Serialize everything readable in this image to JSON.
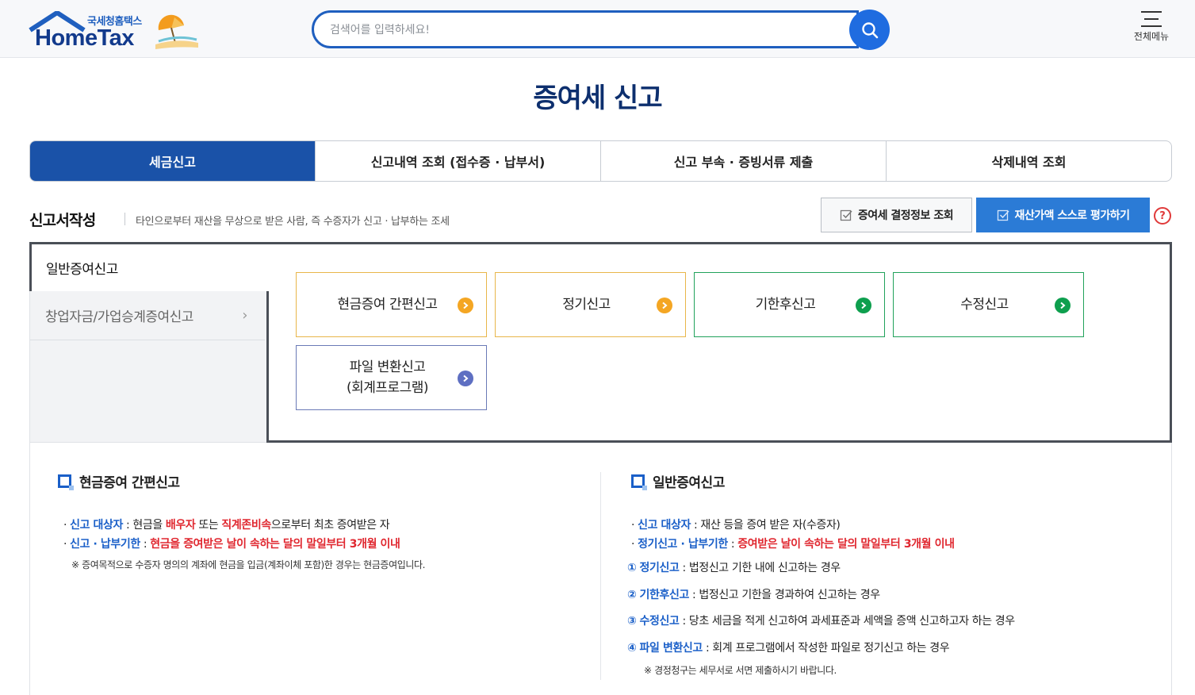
{
  "header": {
    "logo_top": "국세청홈택스",
    "logo_main": "HomeTax",
    "search_placeholder": "검색어를 입력하세요!",
    "menu_label": "전체메뉴"
  },
  "page_title": "증여세 신고",
  "tabs": [
    {
      "label": "세금신고",
      "active": true
    },
    {
      "label": "신고내역 조회 (접수증 · 납부서)"
    },
    {
      "label": "신고 부속 · 증빙서류 제출"
    },
    {
      "label": "삭제내역 조회"
    }
  ],
  "section": {
    "title": "신고서작성",
    "desc": "타인으로부터 재산을 무상으로 받은 사람, 즉 수증자가 신고 · 납부하는 조세",
    "btn_info": "증여세 결정정보 조회",
    "btn_eval": "재산가액 스스로 평가하기",
    "help": "?"
  },
  "left_menu": [
    {
      "label": "일반증여신고",
      "active": true
    },
    {
      "label": "창업자금/가업승계증여신고"
    }
  ],
  "cards": [
    {
      "label": "현금증여 간편신고",
      "color": "orange"
    },
    {
      "label": "정기신고",
      "color": "orange"
    },
    {
      "label": "기한후신고",
      "color": "green"
    },
    {
      "label": "수정신고",
      "color": "green"
    },
    {
      "label_1": "파일 변환신고",
      "label_2": "(회계프로그램)",
      "color": "purple"
    }
  ],
  "info_left": {
    "title": "현금증여 간편신고",
    "l1": {
      "a": "신고 대상자",
      "b": " : 현금을 ",
      "c": "배우자",
      "d": " 또는 ",
      "e": "직계존비속",
      "f": "으로부터 최초 증여받은 자"
    },
    "l2": {
      "a": "신고 · 납부기한",
      "b": " : ",
      "c": "현금을 증여받은 날이 속하는 달의 말일부터 3개월 이내"
    },
    "note": "※ 증여목적으로 수증자 명의의 계좌에 현금을 입금(계좌이체 포함)한 경우는 현금증여입니다."
  },
  "info_right": {
    "title": "일반증여신고",
    "l1": {
      "a": "신고 대상자",
      "b": " : 재산 등을 증여 받은 자(수증자)"
    },
    "l2": {
      "a": "정기신고 · 납부기한",
      "b": " : ",
      "c": "증여받은 날이 속하는 달의 말일부터 3개월 이내"
    },
    "items": [
      {
        "num": "①",
        "name": "정기신고",
        "desc": " : 법정신고 기한 내에 신고하는 경우"
      },
      {
        "num": "②",
        "name": "기한후신고",
        "desc": " : 법정신고 기한을 경과하여 신고하는 경우"
      },
      {
        "num": "③",
        "name": "수정신고",
        "desc": " : 당초 세금을 적게 신고하여 과세표준과 세액을 증액 신고하고자 하는 경우"
      },
      {
        "num": "④",
        "name": "파일 변환신고",
        "desc": " : 회계 프로그램에서 작성한 파일로 정기신고 하는 경우"
      }
    ],
    "note": "※ 경정청구는 세무서로 서면 제출하시기 바랍니다."
  },
  "colors": {
    "brand": "#1a52a8",
    "accent": "#2b7bd6",
    "orange": "#f4a623",
    "green": "#0e9f4e",
    "red": "#e0272f"
  },
  "icons": [
    "house-icon",
    "umbrella-icon",
    "search-icon",
    "hamburger-icon",
    "check-icon",
    "help-icon",
    "chevron-right-icon",
    "arrow-right-icon",
    "checkbox-square-icon"
  ]
}
